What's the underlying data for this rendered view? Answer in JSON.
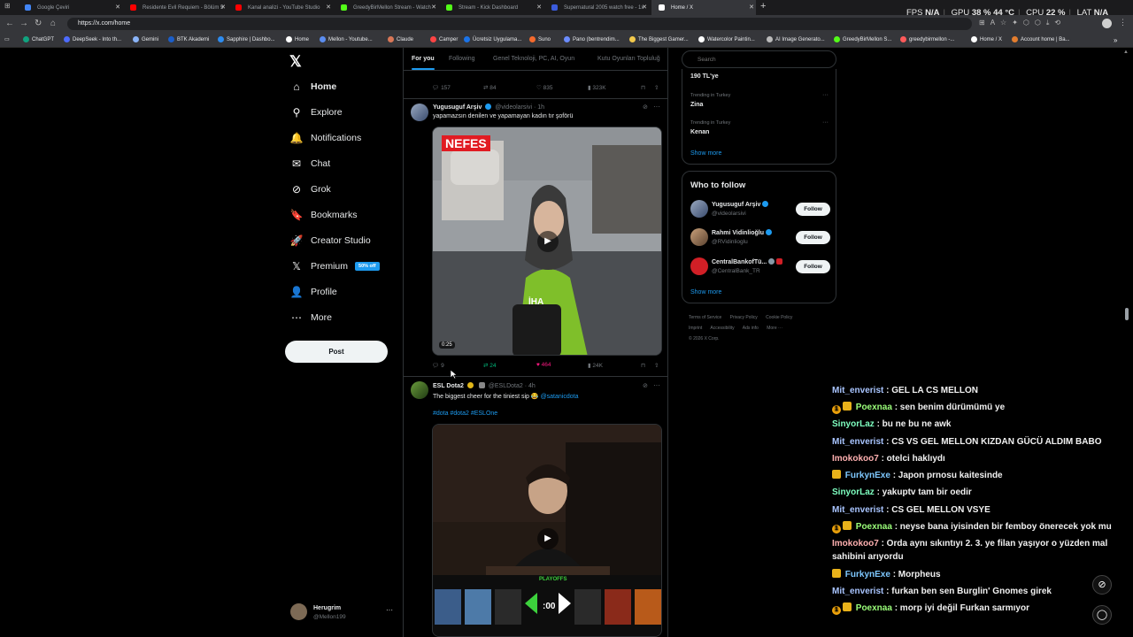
{
  "browser": {
    "tabs": [
      {
        "label": "Google Çeviri",
        "color": "#4285f4"
      },
      {
        "label": "Residente Evil Requiem - Bölüm 5",
        "color": "#ff0000"
      },
      {
        "label": "Kanal analizi - YouTube Studio",
        "color": "#ff0000"
      },
      {
        "label": "GreedyBirMellon Stream - Watch",
        "color": "#53fc18"
      },
      {
        "label": "Stream - Kick Dashboard",
        "color": "#53fc18"
      },
      {
        "label": "Supernatural 2005 watch free - 1x",
        "color": "#3b5bdb"
      },
      {
        "label": "Home / X",
        "color": "#ffffff"
      }
    ],
    "url": "https://x.com/home",
    "bookmarks": [
      {
        "label": "ChatGPT",
        "color": "#10a37f"
      },
      {
        "label": "DeepSeek - Into th...",
        "color": "#4d6bfe"
      },
      {
        "label": "Gemini",
        "color": "#8ab4f8"
      },
      {
        "label": "BTK Akademi",
        "color": "#1b5ec9"
      },
      {
        "label": "Sapphire | Dashbo...",
        "color": "#2d8cf0"
      },
      {
        "label": "Home",
        "color": "#ffffff"
      },
      {
        "label": "Mellon - Youtube...",
        "color": "#5b8def"
      },
      {
        "label": "Claude",
        "color": "#d97757"
      },
      {
        "label": "Camper",
        "color": "#ff4444"
      },
      {
        "label": "Ücretsiz Uygulama...",
        "color": "#1a73e8"
      },
      {
        "label": "Suno",
        "color": "#f56a2d"
      },
      {
        "label": "Pano (bentrendim...",
        "color": "#6b8cff"
      },
      {
        "label": "The Biggest Gamer...",
        "color": "#f2c94c"
      },
      {
        "label": "Watercolor Paintin...",
        "color": "#ffffff"
      },
      {
        "label": "AI Image Generato...",
        "color": "#bbbbbb"
      },
      {
        "label": "GreedyBirMellon S...",
        "color": "#53fc18"
      },
      {
        "label": "greedybirmellon -...",
        "color": "#ff5a5a"
      },
      {
        "label": "Home / X",
        "color": "#ffffff"
      },
      {
        "label": "Account home | Ba...",
        "color": "#e37d2e"
      }
    ],
    "overlay": {
      "fps_label": "FPS",
      "fps_value": "N/A",
      "gpu_label": "GPU",
      "gpu_value": "38 %",
      "gpu_temp": "44 °C",
      "cpu_label": "CPU",
      "cpu_value": "22 %",
      "lat_label": "LAT",
      "lat_value": "N/A"
    }
  },
  "sidebar": {
    "logo": "𝕏",
    "items": [
      {
        "label": "Home",
        "icon": "⌂"
      },
      {
        "label": "Explore",
        "icon": "⚲"
      },
      {
        "label": "Notifications",
        "icon": "🔔"
      },
      {
        "label": "Chat",
        "icon": "✉"
      },
      {
        "label": "Grok",
        "icon": "⊘"
      },
      {
        "label": "Bookmarks",
        "icon": "🔖"
      },
      {
        "label": "Creator Studio",
        "icon": "🚀"
      },
      {
        "label": "Premium",
        "icon": "𝕏"
      },
      {
        "label": "Profile",
        "icon": "👤"
      },
      {
        "label": "More",
        "icon": "⋯"
      }
    ],
    "premium_badge": "50% off",
    "post_label": "Post",
    "account": {
      "name": "Herugrim",
      "handle": "@Mellon199"
    }
  },
  "feed": {
    "tabs": [
      "For you",
      "Following",
      "Genel Teknoloji, PC, AI, Oyun",
      "Kutu Oyunları Topluluğ"
    ],
    "top_actions": {
      "replies": "157",
      "reposts": "84",
      "likes": "835",
      "views": "323K"
    },
    "tweets": [
      {
        "name": "Yugusuguf Arşiv",
        "handle": "@videolarsivi",
        "time": "· 1h",
        "text": "yapamazsın denilen ve yapamayan kadın tır şoförü",
        "media_overlay": "NEFES",
        "media_watermark": "İHA",
        "duration": "0:25",
        "replies": "9",
        "reposts": "24",
        "likes": "464",
        "views": "24K"
      },
      {
        "name": "ESL Dota2",
        "handle": "@ESLDota2",
        "time": "· 4h",
        "text": "The biggest cheer for the tiniest sip 😂",
        "mention": "@satanicdota",
        "hashtags": "#dota #dota2 #ESLOne",
        "media_overlay": "PLAYOFFS",
        "media_timer": ":00"
      }
    ]
  },
  "right": {
    "search_placeholder": "Search",
    "trend_top": "190 TL'ye",
    "trends": [
      {
        "context": "Trending in Turkey",
        "name": "Zina"
      },
      {
        "context": "Trending in Turkey",
        "name": "Kenan"
      }
    ],
    "show_more": "Show more",
    "who_to_follow": "Who to follow",
    "follow_label": "Follow",
    "suggestions": [
      {
        "name": "Yugusuguf Arşiv",
        "handle": "@videolarsivi",
        "color": "#3a5a8c"
      },
      {
        "name": "Rahmi Vidinlioğlu",
        "handle": "@RVidinlioglu",
        "color": "#8a6b4e"
      },
      {
        "name": "CentralBankofTü...",
        "handle": "@CentralBank_TR",
        "color": "#d11f26"
      }
    ],
    "footer": [
      "Terms of Service",
      "Privacy Policy",
      "Cookie Policy",
      "Imprint",
      "Accessibility",
      "Ads info",
      "More ···",
      "© 2026 X Corp."
    ]
  },
  "chat": [
    {
      "user": "Mit_enverist",
      "color": "#a9c5ff",
      "text": ": GEL LA CS MELLON",
      "badges": ""
    },
    {
      "user": "Poexnaa",
      "color": "#9bff7a",
      "text": ": sen benim dürümümü ye",
      "badges": "sub"
    },
    {
      "user": "SinyorLaz",
      "color": "#7effc0",
      "text": ": bu ne bu ne awk",
      "badges": ""
    },
    {
      "user": "Mit_enverist",
      "color": "#a9c5ff",
      "text": ": CS VS GEL MELLON KIZDAN GÜCÜ ALDIM BABO",
      "badges": ""
    },
    {
      "user": "Imokokoo7",
      "color": "#ffb0b0",
      "text": ": otelci haklıydı",
      "badges": ""
    },
    {
      "user": "FurkynExe",
      "color": "#7ec8ff",
      "text": ": Japon prnosu kaitesinde",
      "badges": "crown"
    },
    {
      "user": "SinyorLaz",
      "color": "#7effc0",
      "text": ": yakuptv tam bir oedir",
      "badges": ""
    },
    {
      "user": "Mit_enverist",
      "color": "#a9c5ff",
      "text": ": CS GEL MELLON VSYE",
      "badges": ""
    },
    {
      "user": "Poexnaa",
      "color": "#9bff7a",
      "text": ": neyse bana iyisinden bir femboy önerecek yok mu",
      "badges": "sub"
    },
    {
      "user": "Imokokoo7",
      "color": "#ffb0b0",
      "text": ": Orda aynı sıkıntıyı 2. 3. ye filan yaşıyor o yüzden mal sahibini arıyordu",
      "badges": ""
    },
    {
      "user": "FurkynExe",
      "color": "#7ec8ff",
      "text": ": Morpheus",
      "badges": "crown"
    },
    {
      "user": "Mit_enverist",
      "color": "#a9c5ff",
      "text": ": furkan ben sen Burglin' Gnomes girek",
      "badges": ""
    },
    {
      "user": "Poexnaa",
      "color": "#9bff7a",
      "text": ": morp iyi değil Furkan sarmıyor",
      "badges": "sub"
    }
  ]
}
